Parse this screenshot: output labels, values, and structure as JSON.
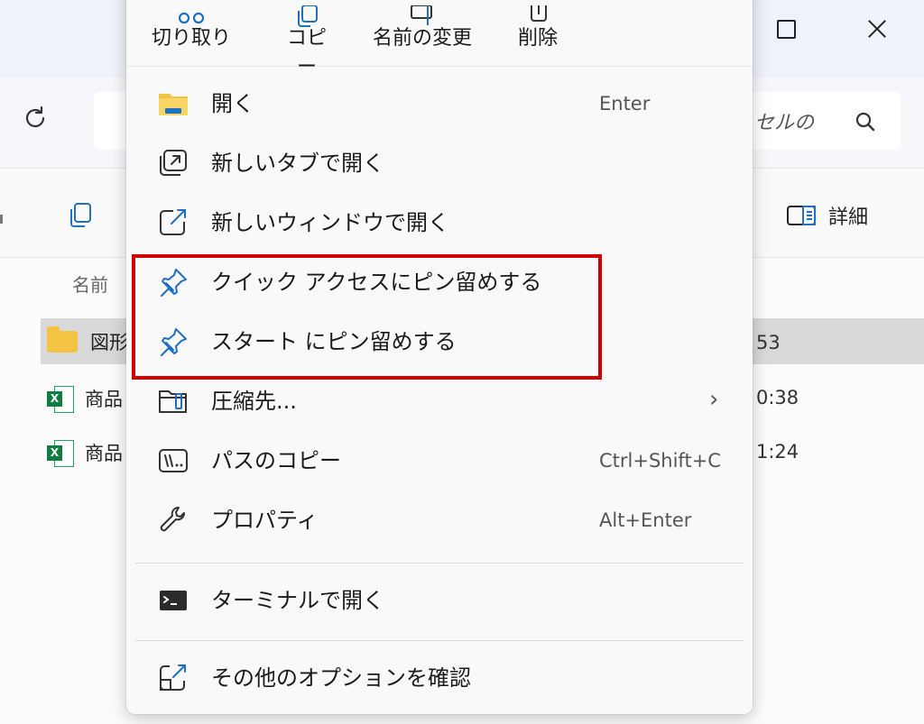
{
  "explorer": {
    "search_placeholder": "セルの",
    "toolbar": {
      "details_label": "詳細"
    },
    "columns": {
      "name_header": "名前"
    },
    "files": [
      {
        "name": "図形",
        "time": "53",
        "type": "folder"
      },
      {
        "name": "商品",
        "time": "0:38",
        "type": "excel"
      },
      {
        "name": "商品",
        "time": "1:24",
        "type": "excel"
      }
    ],
    "excel_badge": "X"
  },
  "context_menu": {
    "quick_actions": [
      {
        "label": "切り取り",
        "icon": "cut-icon"
      },
      {
        "label": "コピー",
        "icon": "copy-icon"
      },
      {
        "label": "名前の変更",
        "icon": "rename-icon"
      },
      {
        "label": "削除",
        "icon": "delete-icon"
      }
    ],
    "items": [
      {
        "label": "開く",
        "shortcut": "Enter",
        "icon": "folder-icon"
      },
      {
        "label": "新しいタブで開く",
        "shortcut": "",
        "icon": "new-tab-icon"
      },
      {
        "label": "新しいウィンドウで開く",
        "shortcut": "",
        "icon": "new-window-icon"
      },
      {
        "label": "クイック アクセスにピン留めする",
        "shortcut": "",
        "icon": "pin-icon"
      },
      {
        "label": "スタート にピン留めする",
        "shortcut": "",
        "icon": "pin-icon"
      },
      {
        "label": "圧縮先...",
        "shortcut": "",
        "icon": "zip-icon",
        "has_submenu": true
      },
      {
        "label": "パスのコピー",
        "shortcut": "Ctrl+Shift+C",
        "icon": "copy-path-icon"
      },
      {
        "label": "プロパティ",
        "shortcut": "Alt+Enter",
        "icon": "wrench-icon"
      },
      {
        "label": "ターミナルで開く",
        "shortcut": "",
        "icon": "terminal-icon"
      },
      {
        "label": "その他のオプションを確認",
        "shortcut": "",
        "icon": "more-options-icon"
      }
    ],
    "highlight_color": "#d10000",
    "accent_color": "#1f6fc5"
  }
}
